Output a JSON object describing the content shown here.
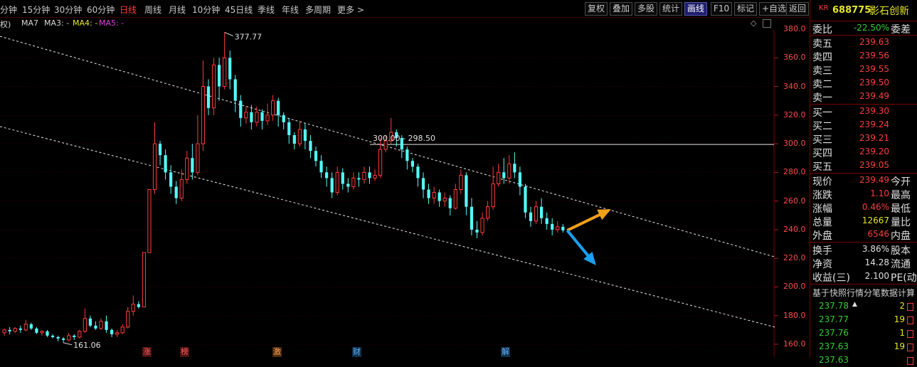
{
  "toolbar": {
    "periods": [
      "分钟",
      "15分钟",
      "30分钟",
      "60分钟",
      "日线",
      "周线",
      "月线",
      "10分钟",
      "45日线",
      "季线",
      "年线",
      "多周期",
      "更多 >"
    ],
    "active_period": "日线",
    "right_buttons": [
      "复权",
      "叠加",
      "多股",
      "统计",
      "画线",
      "F10",
      "标记",
      "+自选",
      "返回"
    ],
    "highlighted_button": "画线"
  },
  "legend": {
    "prefix": "权)",
    "ma7": "MA7",
    "ma3": "MA3: -",
    "ma4": "MA4: -",
    "ma5": "MA5: -",
    "colors": {
      "ma7": "#d8d8d8",
      "ma3": "#d8d8d8",
      "ma4": "#e6e62a",
      "ma5": "#e040e0"
    }
  },
  "chart_data": {
    "type": "candlestick",
    "y_axis_ticks": [
      "380.0",
      "360.0",
      "340.0",
      "320.0",
      "300.0",
      "280.0",
      "260.0",
      "240.0",
      "220.0",
      "200.0",
      "180.0",
      "160.0"
    ],
    "ylim": [
      150,
      383
    ],
    "high_label": "377.77",
    "low_label": "161.06",
    "hline_label": "300.00 - 298.50",
    "hline_value": 299.5,
    "event_markers": [
      "涨",
      "榜",
      "激",
      "财",
      "解"
    ],
    "candles": [
      [
        168,
        170,
        166,
        171
      ],
      [
        170,
        169,
        167,
        172
      ],
      [
        169,
        171,
        168,
        172
      ],
      [
        171,
        170,
        168,
        173
      ],
      [
        170,
        174,
        169,
        177
      ],
      [
        174,
        171,
        170,
        175
      ],
      [
        171,
        168,
        167,
        172
      ],
      [
        168,
        169,
        166,
        170
      ],
      [
        169,
        166,
        165,
        170
      ],
      [
        166,
        165,
        164,
        167
      ],
      [
        165,
        164,
        162,
        166
      ],
      [
        164,
        163,
        161.06,
        165
      ],
      [
        163,
        166,
        162,
        168
      ],
      [
        166,
        165,
        163,
        167
      ],
      [
        165,
        169,
        164,
        170
      ],
      [
        169,
        178,
        168,
        185
      ],
      [
        178,
        173,
        172,
        180
      ],
      [
        173,
        171,
        170,
        176
      ],
      [
        171,
        176,
        170,
        178
      ],
      [
        176,
        170,
        168,
        180
      ],
      [
        170,
        167,
        165,
        171
      ],
      [
        167,
        168,
        165,
        170
      ],
      [
        168,
        172,
        167,
        174
      ],
      [
        172,
        183,
        171,
        186
      ],
      [
        183,
        188,
        180,
        194
      ],
      [
        188,
        186,
        185,
        190
      ],
      [
        186,
        224,
        186,
        224
      ],
      [
        224,
        268,
        224,
        268
      ],
      [
        268,
        300,
        265,
        315
      ],
      [
        300,
        292,
        285,
        302
      ],
      [
        292,
        280,
        275,
        296
      ],
      [
        280,
        270,
        265,
        285
      ],
      [
        270,
        262,
        258,
        274
      ],
      [
        262,
        275,
        260,
        282
      ],
      [
        275,
        290,
        272,
        295
      ],
      [
        290,
        280,
        275,
        300
      ],
      [
        280,
        300,
        278,
        320
      ],
      [
        300,
        340,
        295,
        358
      ],
      [
        340,
        325,
        320,
        345
      ],
      [
        325,
        355,
        320,
        360
      ],
      [
        355,
        340,
        330,
        360
      ],
      [
        340,
        360,
        338,
        377.77
      ],
      [
        360,
        345,
        338,
        365
      ],
      [
        345,
        330,
        322,
        348
      ],
      [
        330,
        318,
        312,
        334
      ],
      [
        318,
        322,
        314,
        326
      ],
      [
        322,
        315,
        310,
        327
      ],
      [
        315,
        322,
        312,
        326
      ],
      [
        322,
        316,
        310,
        324
      ],
      [
        316,
        320,
        313,
        328
      ],
      [
        320,
        330,
        316,
        334
      ],
      [
        330,
        320,
        312,
        332
      ],
      [
        320,
        315,
        310,
        322
      ],
      [
        315,
        306,
        300,
        318
      ],
      [
        306,
        300,
        296,
        308
      ],
      [
        300,
        310,
        298,
        316
      ],
      [
        310,
        302,
        296,
        314
      ],
      [
        302,
        295,
        290,
        306
      ],
      [
        295,
        288,
        284,
        298
      ],
      [
        288,
        280,
        276,
        292
      ],
      [
        280,
        276,
        270,
        284
      ],
      [
        276,
        266,
        262,
        280
      ],
      [
        266,
        280,
        264,
        284
      ],
      [
        280,
        272,
        268,
        283
      ],
      [
        272,
        270,
        266,
        276
      ],
      [
        270,
        276,
        268,
        280
      ],
      [
        276,
        275,
        270,
        280
      ],
      [
        275,
        280,
        272,
        284
      ],
      [
        280,
        276,
        272,
        284
      ],
      [
        276,
        278,
        274,
        282
      ],
      [
        278,
        296,
        276,
        304
      ],
      [
        296,
        302,
        294,
        306
      ],
      [
        302,
        308,
        300,
        318
      ],
      [
        308,
        304,
        298,
        310
      ],
      [
        304,
        296,
        290,
        306
      ],
      [
        296,
        288,
        282,
        298
      ],
      [
        288,
        284,
        280,
        290
      ],
      [
        284,
        276,
        270,
        286
      ],
      [
        276,
        268,
        262,
        280
      ],
      [
        268,
        262,
        258,
        272
      ],
      [
        262,
        266,
        258,
        270
      ],
      [
        266,
        260,
        256,
        268
      ],
      [
        260,
        262,
        256,
        266
      ],
      [
        262,
        255,
        250,
        264
      ],
      [
        255,
        268,
        254,
        272
      ],
      [
        268,
        278,
        265,
        282
      ],
      [
        278,
        256,
        250,
        280
      ],
      [
        256,
        240,
        236,
        262
      ],
      [
        240,
        238,
        234,
        246
      ],
      [
        238,
        248,
        236,
        252
      ],
      [
        248,
        256,
        246,
        260
      ],
      [
        256,
        272,
        254,
        284
      ],
      [
        272,
        280,
        270,
        286
      ],
      [
        280,
        276,
        272,
        290
      ],
      [
        276,
        286,
        272,
        292
      ],
      [
        286,
        280,
        276,
        294
      ],
      [
        280,
        270,
        264,
        284
      ],
      [
        270,
        252,
        248,
        272
      ],
      [
        252,
        246,
        242,
        256
      ],
      [
        246,
        256,
        244,
        260
      ],
      [
        256,
        248,
        244,
        262
      ],
      [
        248,
        244,
        240,
        252
      ],
      [
        244,
        240,
        236,
        248
      ],
      [
        240,
        242,
        238,
        246
      ],
      [
        242,
        239.5,
        238,
        244
      ]
    ],
    "trend_lines": [
      {
        "from": [
          0,
          375
        ],
        "to": [
          1089,
          221
        ]
      },
      {
        "from": [
          0,
          312
        ],
        "to": [
          1089,
          172
        ]
      }
    ],
    "arrows": [
      {
        "color": "#f0a018",
        "direction": "up"
      },
      {
        "color": "#1aa0f0",
        "direction": "down"
      }
    ]
  },
  "panel": {
    "code_prefix": "KR",
    "code": "688775",
    "name": "影石创新",
    "ratio_label": "委比",
    "ratio_value": "-22.50%",
    "ratio_tail": "委差",
    "sells": [
      {
        "label": "卖五",
        "price": "239.63"
      },
      {
        "label": "卖四",
        "price": "239.56"
      },
      {
        "label": "卖三",
        "price": "239.55"
      },
      {
        "label": "卖二",
        "price": "239.50"
      },
      {
        "label": "卖一",
        "price": "239.49"
      }
    ],
    "buys": [
      {
        "label": "买一",
        "price": "239.30"
      },
      {
        "label": "买二",
        "price": "239.24"
      },
      {
        "label": "买三",
        "price": "239.21"
      },
      {
        "label": "买四",
        "price": "239.20"
      },
      {
        "label": "买五",
        "price": "239.05"
      }
    ],
    "stats": [
      {
        "label": "现价",
        "value": "239.49",
        "tail": "今开",
        "color": "#ff3c3c"
      },
      {
        "label": "涨跌",
        "value": "1.10",
        "tail": "最高",
        "color": "#ff3c3c"
      },
      {
        "label": "涨幅",
        "value": "0.46%",
        "tail": "最低",
        "color": "#ff3c3c"
      },
      {
        "label": "总量",
        "value": "12667",
        "tail": "量比",
        "color": "#e6e62a"
      },
      {
        "label": "外盘",
        "value": "6546",
        "tail": "内盘",
        "color": "#ff3c3c"
      }
    ],
    "stats2": [
      {
        "label": "换手",
        "value": "3.86%",
        "tail": "股本",
        "color": "#e0e0e0"
      },
      {
        "label": "净资",
        "value": "14.28",
        "tail": "流通",
        "color": "#e0e0e0"
      },
      {
        "label": "收益(三)",
        "value": "2.100",
        "tail": "PE(动",
        "color": "#e0e0e0"
      }
    ],
    "snapshot_note": "基于快照行情分笔数据计算",
    "ticks": [
      {
        "price": "237.78",
        "arrow": "▲",
        "vol": "2"
      },
      {
        "price": "237.77",
        "arrow": "",
        "vol": "19"
      },
      {
        "price": "237.76",
        "arrow": "",
        "vol": "1"
      },
      {
        "price": "237.63",
        "arrow": "",
        "vol": "19"
      },
      {
        "price": "237.63",
        "arrow": "",
        "vol": ""
      }
    ]
  }
}
